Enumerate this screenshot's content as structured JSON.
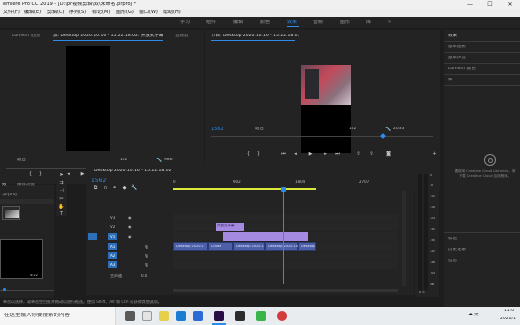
{
  "app": {
    "title": "emiere Pro CC 2019 - [D:\\pr视频剪辑\\双\\未命名.prproj *",
    "window_controls": [
      "—",
      "☐",
      "✕"
    ]
  },
  "menu": [
    "文件(F)",
    "编辑(E)",
    "剪辑(C)",
    "序列(S)",
    "标记(M)",
    "图形(G)",
    "窗口(W)",
    "帮助(H)"
  ],
  "workspaces": {
    "items": [
      "学习",
      "组件",
      "编辑",
      "颜色",
      "效果",
      "音频",
      "图形",
      "库"
    ],
    "active_index": 4,
    "overflow": "»"
  },
  "source_monitor": {
    "tabs": [
      "Lumetri 范围",
      "源: Desktop 2020.10.16 - 15.22.18.02: 开放式字幕: 217",
      "音频剪"
    ],
    "active_tab": 1,
    "timecode_left": "",
    "fit": "适合",
    "fraction": "1/2",
    "duration": "986",
    "colors": {
      "accent": "#2d8ceb"
    }
  },
  "program_monitor": {
    "tab": "节目: Desktop 2020.10.16 - 15.22.18.0;",
    "timecode": "1562",
    "fit": "适合",
    "fraction": "1/2",
    "duration": "2033"
  },
  "project_panel": {
    "tabs": [
      "效",
      "媒体浏览"
    ],
    "items": [
      ".prproj",
      "",
      "",
      "4:22"
    ]
  },
  "timeline": {
    "tab": "Desktop 2020.10.16 - 15.22.18.02",
    "timecode": "1562",
    "ruler": [
      "0",
      "902",
      "1804",
      "2707"
    ],
    "video_tracks": [
      "V3",
      "V2",
      "V1"
    ],
    "audio_tracks": [
      "A1",
      "A2",
      "A3"
    ],
    "master": "主声道",
    "master_value": "0.0",
    "video_clip": "开放式字幕",
    "audio_clips": [
      "Desktop 2020.1",
      "Crude",
      "Desktop 2020.1",
      "Desktop 2020.10",
      "Desktop"
    ],
    "meter_labels": [
      "0",
      "-6",
      "-12",
      "-18",
      "-24",
      "-30",
      "-36",
      "-42",
      "-48",
      "-54",
      "dB"
    ],
    "meter_solo": "S S"
  },
  "right_panel": {
    "tabs": [
      "效果",
      "基本图形",
      "基本声音",
      "Lumetri 颜色",
      "库"
    ],
    "cc_message": "要使用 Creative Cloud Libraries，请下载 Creative Cloud 应用程序。",
    "bottom_tabs": [
      "标记",
      "历史记录",
      "信息"
    ]
  },
  "status_bar": {
    "text": "单击以选择，或单击空白处并拖动以进行框选。使用 Shift、Alt 和 Ctrl 可获得其他选项。"
  },
  "taskbar": {
    "search_placeholder": "在这里输入你要搜索的内容",
    "time": "11:0",
    "date": "2020/1",
    "tray": "^ ☁ 英"
  }
}
